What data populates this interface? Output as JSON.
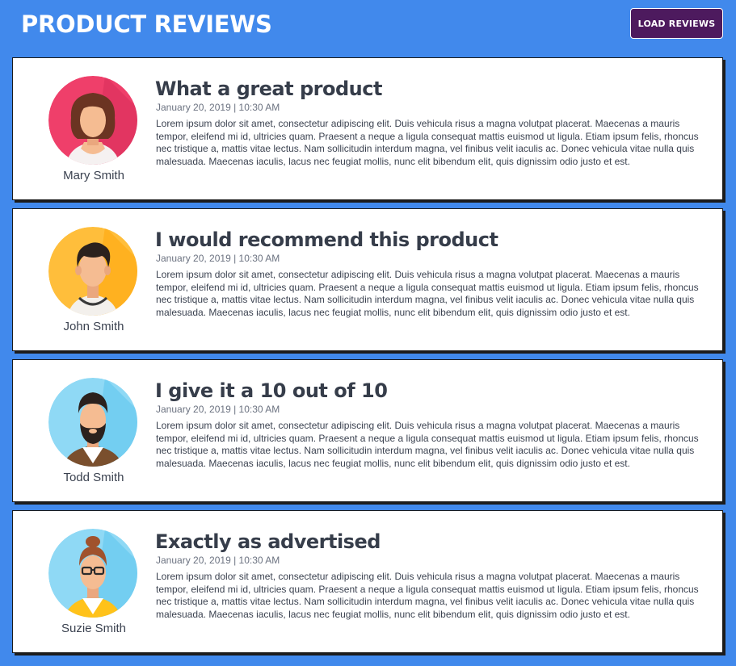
{
  "header": {
    "title": "PRODUCT REVIEWS",
    "load_button": "LOAD REVIEWS"
  },
  "colors": {
    "background": "#4189ec",
    "button": "#4d1a5e",
    "card": "#ffffff"
  },
  "reviews": [
    {
      "name": "Mary Smith",
      "avatar_icon": "woman-brown-hair-avatar",
      "avatar_color": "#ef3f6a",
      "title": "What a great product",
      "date": "January 20, 2019 | 10:30 AM",
      "body": "Lorem ipsum dolor sit amet, consectetur adipiscing elit. Duis vehicula risus a magna volutpat placerat. Maecenas a mauris tempor, eleifend mi id, ultricies quam. Praesent a neque a ligula consequat mattis euismod ut ligula. Etiam ipsum felis, rhoncus nec tristique a, mattis vitae lectus. Nam sollicitudin interdum magna, vel finibus velit iaculis ac. Donec vehicula vitae nulla quis malesuada. Maecenas iaculis, lacus nec feugiat mollis, nunc elit bibendum elit, quis dignissim odio justo et est."
    },
    {
      "name": "John Smith",
      "avatar_icon": "man-curly-hair-avatar",
      "avatar_color": "#ffbe3b",
      "title": "I would recommend this product",
      "date": "January 20, 2019 | 10:30 AM",
      "body": "Lorem ipsum dolor sit amet, consectetur adipiscing elit. Duis vehicula risus a magna volutpat placerat. Maecenas a mauris tempor, eleifend mi id, ultricies quam. Praesent a neque a ligula consequat mattis euismod ut ligula. Etiam ipsum felis, rhoncus nec tristique a, mattis vitae lectus. Nam sollicitudin interdum magna, vel finibus velit iaculis ac. Donec vehicula vitae nulla quis malesuada. Maecenas iaculis, lacus nec feugiat mollis, nunc elit bibendum elit, quis dignissim odio justo et est."
    },
    {
      "name": "Todd Smith",
      "avatar_icon": "bearded-man-avatar",
      "avatar_color": "#6ccbf0",
      "title": "I give it a 10 out of 10",
      "date": "January 20, 2019 | 10:30 AM",
      "body": "Lorem ipsum dolor sit amet, consectetur adipiscing elit. Duis vehicula risus a magna volutpat placerat. Maecenas a mauris tempor, eleifend mi id, ultricies quam. Praesent a neque a ligula consequat mattis euismod ut ligula. Etiam ipsum felis, rhoncus nec tristique a, mattis vitae lectus. Nam sollicitudin interdum magna, vel finibus velit iaculis ac. Donec vehicula vitae nulla quis malesuada. Maecenas iaculis, lacus nec feugiat mollis, nunc elit bibendum elit, quis dignissim odio justo et est."
    },
    {
      "name": "Suzie Smith",
      "avatar_icon": "woman-glasses-bun-avatar",
      "avatar_color": "#6ccbf0",
      "title": "Exactly as advertised",
      "date": "January 20, 2019 | 10:30 AM",
      "body": "Lorem ipsum dolor sit amet, consectetur adipiscing elit. Duis vehicula risus a magna volutpat placerat. Maecenas a mauris tempor, eleifend mi id, ultricies quam. Praesent a neque a ligula consequat mattis euismod ut ligula. Etiam ipsum felis, rhoncus nec tristique a, mattis vitae lectus. Nam sollicitudin interdum magna, vel finibus velit iaculis ac. Donec vehicula vitae nulla quis malesuada. Maecenas iaculis, lacus nec feugiat mollis, nunc elit bibendum elit, quis dignissim odio justo et est."
    }
  ]
}
